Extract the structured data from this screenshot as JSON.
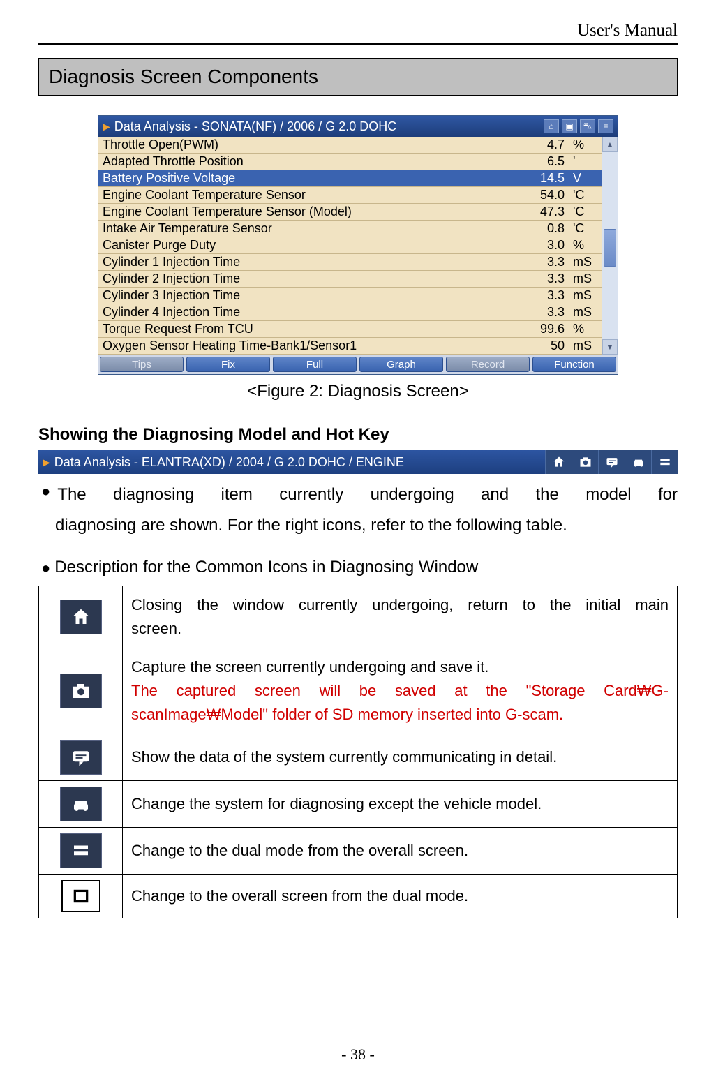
{
  "header": {
    "right": "User's Manual"
  },
  "section_title": "Diagnosis Screen Components",
  "diag_panel": {
    "title": "Data Analysis - SONATA(NF) / 2006 / G 2.0 DOHC",
    "rows": [
      {
        "label": "Throttle Open(PWM)",
        "value": "4.7",
        "unit": "%",
        "selected": false
      },
      {
        "label": "Adapted Throttle Position",
        "value": "6.5",
        "unit": "'",
        "selected": false
      },
      {
        "label": "Battery Positive Voltage",
        "value": "14.5",
        "unit": "V",
        "selected": true
      },
      {
        "label": "Engine Coolant Temperature Sensor",
        "value": "54.0",
        "unit": "'C",
        "selected": false
      },
      {
        "label": "Engine Coolant Temperature Sensor (Model)",
        "value": "47.3",
        "unit": "'C",
        "selected": false
      },
      {
        "label": "Intake Air Temperature Sensor",
        "value": "0.8",
        "unit": "'C",
        "selected": false
      },
      {
        "label": "Canister Purge Duty",
        "value": "3.0",
        "unit": "%",
        "selected": false
      },
      {
        "label": "Cylinder 1 Injection Time",
        "value": "3.3",
        "unit": "mS",
        "selected": false
      },
      {
        "label": "Cylinder 2 Injection Time",
        "value": "3.3",
        "unit": "mS",
        "selected": false
      },
      {
        "label": "Cylinder 3 Injection Time",
        "value": "3.3",
        "unit": "mS",
        "selected": false
      },
      {
        "label": "Cylinder 4 Injection Time",
        "value": "3.3",
        "unit": "mS",
        "selected": false
      },
      {
        "label": "Torque Request From TCU",
        "value": "99.6",
        "unit": "%",
        "selected": false
      },
      {
        "label": "Oxygen Sensor Heating Time-Bank1/Sensor1",
        "value": "50",
        "unit": "mS",
        "selected": false
      }
    ],
    "buttons": [
      "Tips",
      "Fix",
      "Full",
      "Graph",
      "Record",
      "Function"
    ],
    "button_disabled": [
      true,
      false,
      false,
      false,
      true,
      false
    ]
  },
  "fig_caption": "<Figure 2: Diagnosis Screen>",
  "sub1": "Showing the Diagnosing Model and Hot Key",
  "hotkey_title": "Data Analysis - ELANTRA(XD) / 2004 / G 2.0 DOHC / ENGINE",
  "bullet1a": "The   diagnosing   item   currently   undergoing   and   the   model   for",
  "bullet1b": "diagnosing are shown. For the right icons, refer to the following table.",
  "bullet2": "Description for the Common Icons in Diagnosing Window",
  "icon_table": [
    {
      "icon": "home",
      "desc_lines": [
        {
          "text": "Closing the window currently undergoing, return to the initial main",
          "just": true,
          "red": false
        },
        {
          "text": "screen.",
          "just": false,
          "red": false
        }
      ]
    },
    {
      "icon": "camera",
      "desc_lines": [
        {
          "text": "Capture the screen currently undergoing and save it.",
          "just": false,
          "red": false
        },
        {
          "text": "The  captured  screen  will  be  saved  at  the  \"Storage  Card₩G-",
          "just": true,
          "red": true
        },
        {
          "text": "scanImage₩Model\" folder of SD memory inserted into G-scam.",
          "just": false,
          "red": true
        }
      ]
    },
    {
      "icon": "chat",
      "desc_lines": [
        {
          "text": "Show the data of the system currently communicating in detail.",
          "just": false,
          "red": false
        }
      ]
    },
    {
      "icon": "car",
      "desc_lines": [
        {
          "text": "Change the system for diagnosing except the vehicle model.",
          "just": false,
          "red": false
        }
      ]
    },
    {
      "icon": "dual",
      "desc_lines": [
        {
          "text": "Change to the dual mode from the overall screen.",
          "just": false,
          "red": false
        }
      ]
    },
    {
      "icon": "full",
      "desc_lines": [
        {
          "text": "Change to the overall screen from the dual mode.",
          "just": false,
          "red": false
        }
      ]
    }
  ],
  "page_num": "- 38 -"
}
